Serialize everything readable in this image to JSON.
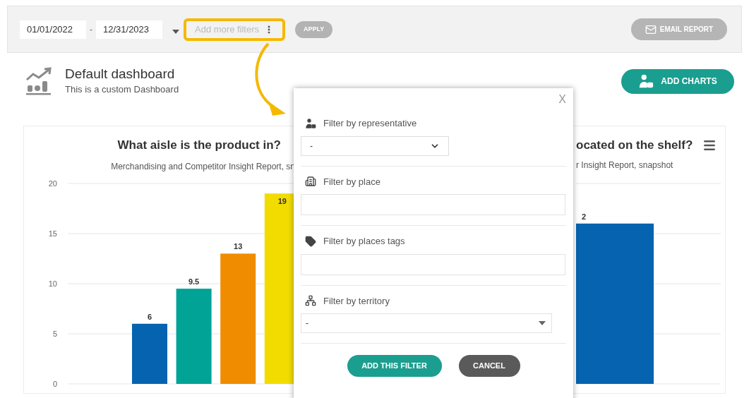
{
  "toolbar": {
    "date_from": "01/01/2022",
    "date_separator": "-",
    "date_to": "12/31/2023",
    "filters_placeholder": "Add more filters",
    "filters_highlighted": true,
    "apply_button": "APPLY",
    "email_button": "EMAIL REPORT"
  },
  "header": {
    "title": "Default dashboard",
    "subtitle": "This is a custom Dashboard",
    "add_button": "ADD CHARTS"
  },
  "charts": [
    {
      "title": "What aisle is the product in?",
      "subtitle": "Merchandising and Competitor Insight Report, sn",
      "chart_data": {
        "type": "bar",
        "values": [
          null,
          6,
          9.5,
          13,
          19
        ],
        "colors": [
          null,
          "#0563b0",
          "#00a396",
          "#f08c00",
          "#f2dc00"
        ],
        "ylim": [
          0,
          20
        ],
        "yticks": [
          0,
          5,
          10,
          15,
          20
        ],
        "grid": true,
        "stacked": false,
        "orientation": "vertical",
        "value_labels": [
          null,
          "6",
          "9.5",
          "13",
          "19"
        ]
      }
    },
    {
      "title": "ocated on the shelf?",
      "subtitle": "r Insight Report, snapshot",
      "bar_label": "2",
      "chart_data": {
        "type": "bar",
        "values": [
          16
        ],
        "colors": [
          "#0563b0"
        ],
        "ylim": [
          0,
          20
        ],
        "grid": true
      }
    }
  ],
  "modal": {
    "close": "X",
    "filters": [
      {
        "kind": "select",
        "label": "Filter by representative",
        "value": "-"
      },
      {
        "kind": "text",
        "label": "Filter by place"
      },
      {
        "kind": "text",
        "label": "Filter by places tags"
      },
      {
        "kind": "dropdown",
        "label": "Filter by territory",
        "value": "-"
      }
    ],
    "buttons": [
      {
        "kind": "primary",
        "label": "ADD THIS FILTER"
      },
      {
        "kind": "secondary",
        "label": "CANCEL"
      }
    ]
  }
}
